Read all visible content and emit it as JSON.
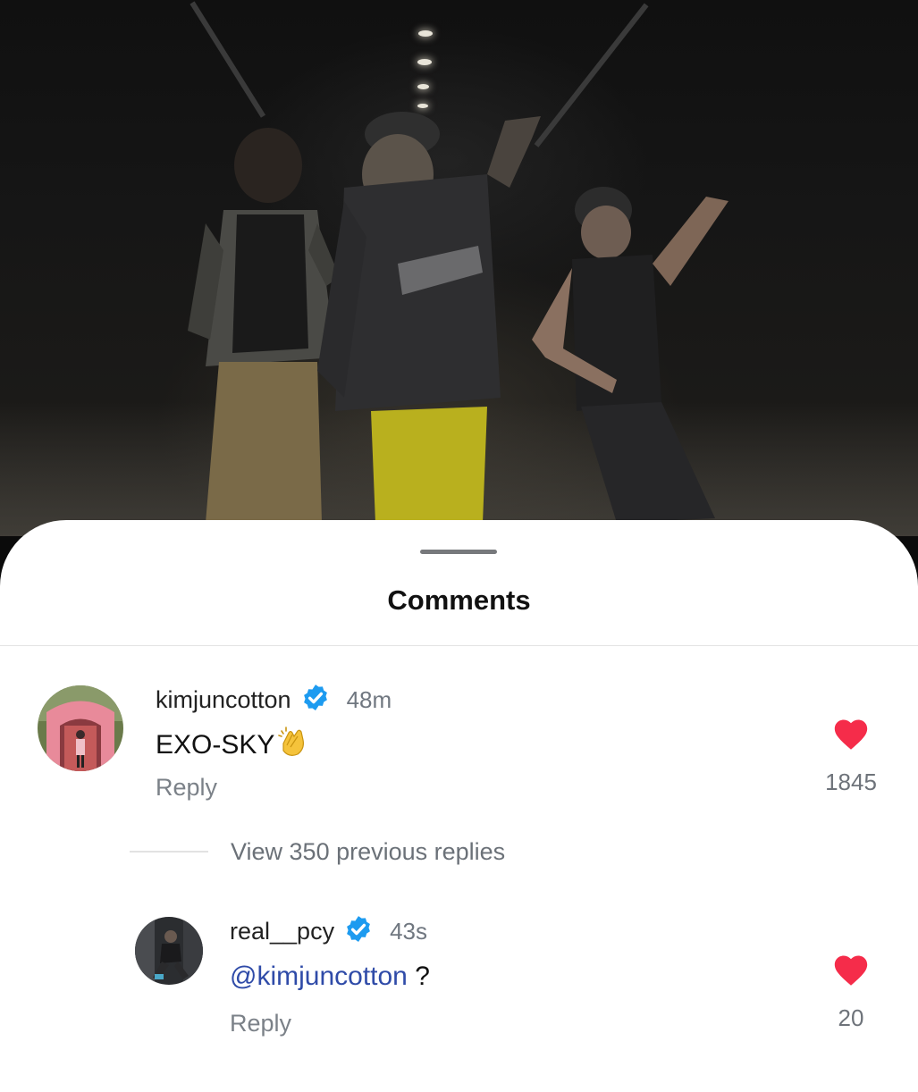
{
  "sheet": {
    "title": "Comments"
  },
  "comments": [
    {
      "username": "kimjuncotton",
      "verified": true,
      "time": "48m",
      "text": "EXO-SKY",
      "emoji": "clapping-hands-icon",
      "reply_label": "Reply",
      "likes": "1845"
    }
  ],
  "thread": {
    "view_replies_label": "View 350 previous replies"
  },
  "replies": [
    {
      "username": "real__pcy",
      "verified": true,
      "time": "43s",
      "mention": "@kimjuncotton",
      "text": " ?",
      "reply_label": "Reply",
      "likes": "20"
    }
  ],
  "colors": {
    "verified_badge": "#1d9bf0",
    "heart": "#f52c4a",
    "mention": "#2f4ba8"
  }
}
